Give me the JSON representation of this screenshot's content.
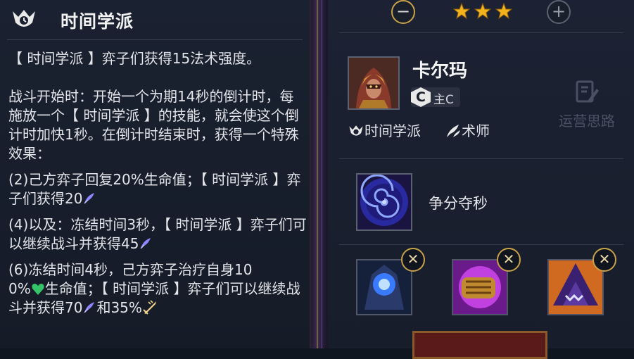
{
  "trait_panel": {
    "title": "时间学派",
    "lines": [
      "【 时间学派 】弈子们获得15法术强度。",
      "战斗开始时：开始一个为期14秒的倒计时，每施放一个【 时间学派 】的技能，就会使这个倒计时加快1秒。在倒计时结束时，获得一个特殊效果：",
      "(2)己方弈子回复20%生命值；【 时间学派 】弈子们获得20",
      "(4)以及：冻结时间3秒，【 时间学派 】弈子们可以继续战斗并获得45",
      "(6)冻结时间4秒，己方弈子治疗自身10",
      "0%",
      "生命值；【 时间学派 】弈子们可以继续战斗并获得70",
      "和35%"
    ]
  },
  "champion_panel": {
    "star_level": 3,
    "minus_label": "−",
    "plus_label": "+",
    "name": "卡尔玛",
    "role_icon_letter": "C",
    "role_label": "主C",
    "traits": [
      "时间学派",
      "术师"
    ],
    "strategy_label": "运营思路",
    "ability_name": "争分夺秒",
    "remove_label": "✕"
  },
  "colors": {
    "accent_gold": "#c8a24a",
    "star_gold": "#f2b21c",
    "ap_purple": "#8f86ff",
    "heal_green": "#35c46a"
  },
  "icons": [
    "chrono-trait-icon",
    "ap-icon",
    "heart-icon",
    "attack-speed-icon",
    "star-icon",
    "sorcerer-trait-icon",
    "strategy-icon"
  ]
}
